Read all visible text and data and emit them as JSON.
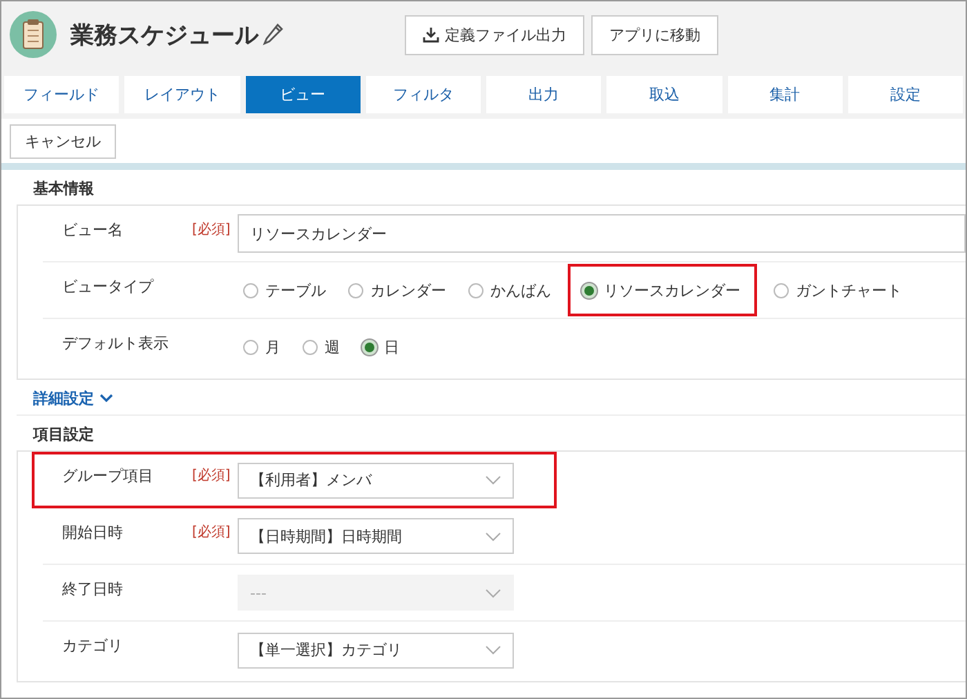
{
  "app": {
    "title": "業務スケジュール"
  },
  "header_buttons": [
    {
      "kind": "download",
      "label": "定義ファイル出力"
    },
    {
      "kind": "plain",
      "label": "アプリに移動"
    }
  ],
  "tabs": [
    {
      "label": "フィールド",
      "selected": false
    },
    {
      "label": "レイアウト",
      "selected": false
    },
    {
      "label": "ビュー",
      "selected": true
    },
    {
      "label": "フィルタ",
      "selected": false
    },
    {
      "label": "出力",
      "selected": false
    },
    {
      "label": "取込",
      "selected": false
    },
    {
      "label": "集計",
      "selected": false
    },
    {
      "label": "設定",
      "selected": false
    }
  ],
  "cancel_button": "キャンセル",
  "basic_info": {
    "title": "基本情報",
    "rows": [
      {
        "kind": "text",
        "label": "ビュー名",
        "required": "[必須]",
        "value": "リソースカレンダー"
      },
      {
        "kind": "radio",
        "label": "ビュータイプ",
        "options": [
          {
            "label": "テーブル",
            "selected": false,
            "highlighted": false
          },
          {
            "label": "カレンダー",
            "selected": false,
            "highlighted": false
          },
          {
            "label": "かんばん",
            "selected": false,
            "highlighted": false
          },
          {
            "label": "リソースカレンダー",
            "selected": true,
            "highlighted": true
          },
          {
            "label": "ガントチャート",
            "selected": false,
            "highlighted": false
          }
        ]
      },
      {
        "kind": "radio",
        "label": "デフォルト表示",
        "options": [
          {
            "label": "月",
            "selected": false,
            "highlighted": false
          },
          {
            "label": "週",
            "selected": false,
            "highlighted": false
          },
          {
            "label": "日",
            "selected": true,
            "highlighted": false
          }
        ]
      }
    ]
  },
  "advanced": {
    "label": "詳細設定",
    "expanded": false
  },
  "item_settings": {
    "title": "項目設定",
    "rows": [
      {
        "kind": "select",
        "label": "グループ項目",
        "required": "[必須]",
        "value": "【利用者】メンバ",
        "disabled": false,
        "highlighted": true
      },
      {
        "kind": "select",
        "label": "開始日時",
        "required": "[必須]",
        "value": "【日時期間】日時期間",
        "disabled": false,
        "highlighted": false
      },
      {
        "kind": "select",
        "label": "終了日時",
        "value": "---",
        "disabled": true,
        "highlighted": false
      },
      {
        "kind": "select",
        "label": "カテゴリ",
        "value": "【単一選択】カテゴリ",
        "disabled": false,
        "highlighted": false
      }
    ]
  }
}
